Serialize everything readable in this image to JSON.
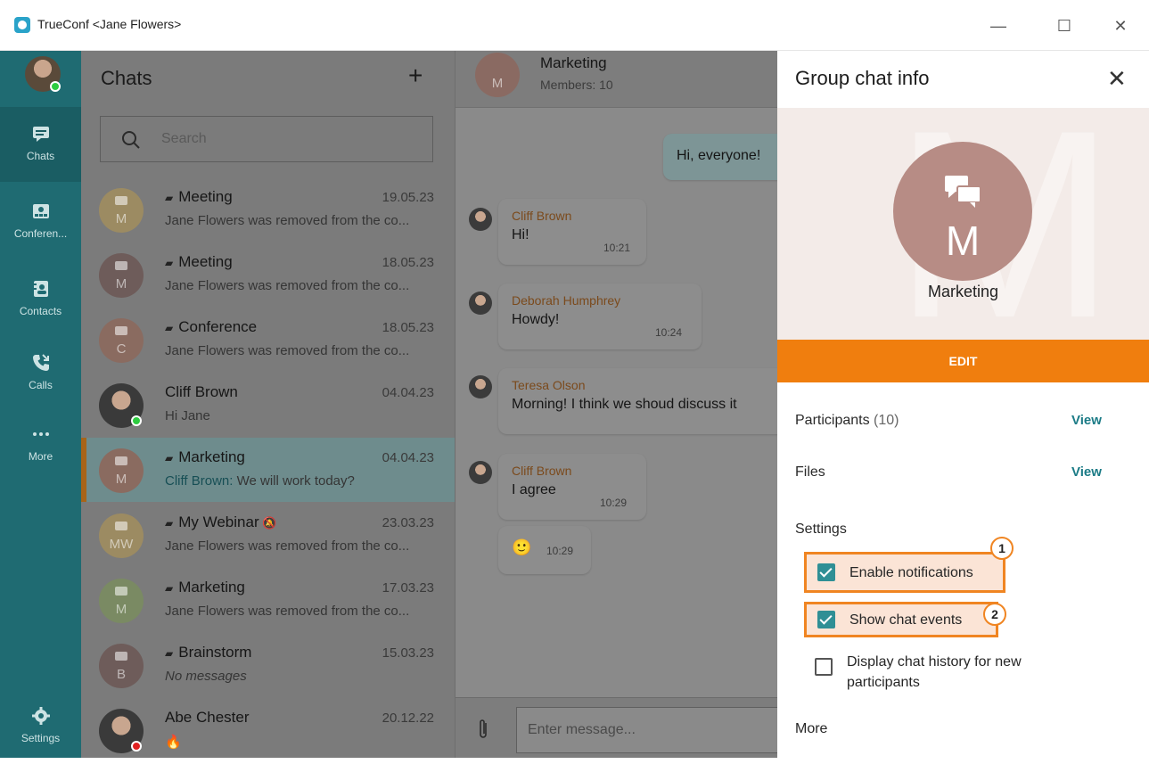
{
  "window": {
    "title": "TrueConf <Jane Flowers>"
  },
  "rail": {
    "items": [
      {
        "label": "Chats",
        "icon": "chat-bubble-icon"
      },
      {
        "label": "Conferen...",
        "icon": "conference-icon"
      },
      {
        "label": "Contacts",
        "icon": "contacts-icon"
      },
      {
        "label": "Calls",
        "icon": "calls-icon"
      },
      {
        "label": "More",
        "icon": "more-dots-icon"
      }
    ],
    "settings_label": "Settings"
  },
  "chats": {
    "title": "Chats",
    "add_symbol": "+",
    "search_placeholder": "Search",
    "items": [
      {
        "name": "Meeting",
        "group": true,
        "date": "19.05.23",
        "initial": "M",
        "avatar_color": "#9c8b62",
        "preview": "Jane Flowers was removed from the co..."
      },
      {
        "name": "Meeting",
        "group": true,
        "date": "18.05.23",
        "initial": "M",
        "avatar_color": "#6e5c5a",
        "preview": "Jane Flowers was removed from the co..."
      },
      {
        "name": "Conference",
        "group": true,
        "date": "18.05.23",
        "initial": "C",
        "avatar_color": "#8a6b60",
        "preview": "Jane Flowers was removed from the co..."
      },
      {
        "name": "Cliff Brown",
        "group": false,
        "date": "04.04.23",
        "initial": "",
        "avatar_color": "#3d3d3d",
        "preview": "Hi Jane"
      },
      {
        "name": "Marketing",
        "group": true,
        "date": "04.04.23",
        "initial": "M",
        "avatar_color": "#8a6b60",
        "preview_from": "Cliff Brown:",
        "preview": "We will work today?"
      },
      {
        "name": "My Webinar",
        "group": true,
        "date": "23.03.23",
        "initial": "MW",
        "avatar_color": "#9c8b62",
        "preview": "Jane Flowers was removed from the co..."
      },
      {
        "name": "Marketing",
        "group": true,
        "date": "17.03.23",
        "initial": "M",
        "avatar_color": "#7a8a63",
        "preview": "Jane Flowers was removed from the co..."
      },
      {
        "name": "Brainstorm",
        "group": true,
        "date": "15.03.23",
        "initial": "B",
        "avatar_color": "#6e5c5a",
        "preview": "No messages"
      },
      {
        "name": "Abe Chester",
        "group": false,
        "date": "20.12.22",
        "initial": "",
        "avatar_color": "#3d3d3d",
        "preview": "🔥"
      }
    ]
  },
  "conversation": {
    "name": "Marketing",
    "initial": "M",
    "members": "Members: 10",
    "messages": [
      {
        "own": true,
        "text": "Hi, everyone!"
      },
      {
        "from": "Cliff Brown",
        "text": "Hi!",
        "time": "10:21"
      },
      {
        "from": "Deborah Humphrey",
        "text": "Howdy!",
        "time": "10:24"
      },
      {
        "from": "Teresa Olson",
        "text": "Morning! I think we shoud discuss it"
      },
      {
        "from": "Cliff Brown",
        "text": "I agree",
        "time": "10:29"
      },
      {
        "emoji": "🙂",
        "time": "10:29"
      }
    ],
    "compose_placeholder": "Enter message..."
  },
  "info": {
    "title": "Group chat info",
    "close_symbol": "✕",
    "group_name": "Marketing",
    "group_initial": "M",
    "edit_label": "EDIT",
    "participants_label": "Participants",
    "participants_count": "(10)",
    "files_label": "Files",
    "view_label": "View",
    "settings_label": "Settings",
    "options": [
      {
        "label": "Enable notifications",
        "checked": true,
        "badge": "1"
      },
      {
        "label": "Show chat events",
        "checked": true,
        "badge": "2"
      },
      {
        "label": "Display chat history for new",
        "label2": "participants",
        "checked": false
      }
    ],
    "more_label": "More"
  },
  "colors": {
    "accent": "#f07e0e",
    "teal": "#1f6b72",
    "link": "#1b7b86"
  }
}
